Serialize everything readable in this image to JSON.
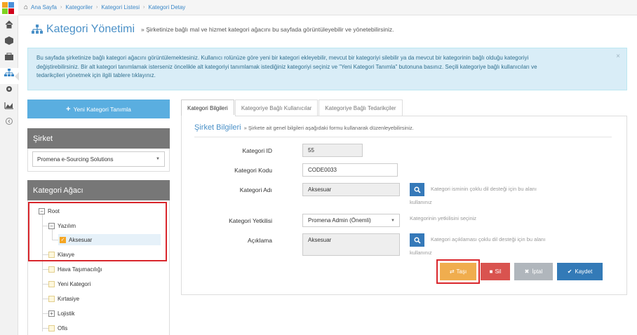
{
  "breadcrumb": {
    "home": "Ana Sayfa",
    "items": [
      "Kategoriler",
      "Kategori Listesi",
      "Kategori Detay"
    ]
  },
  "page": {
    "title": "Kategori Yönetimi",
    "subtitle": "» Şirketinize bağlı mal ve hizmet kategori ağacını bu sayfada görüntüleyebilir ve yönetebilirsiniz."
  },
  "alert": {
    "lines": [
      "Bu sayfada şirketinize bağlı kategori ağacını görüntülemektesiniz. Kullanıcı rolünüze göre yeni bir kategori ekleyebilir, mevcut bir kategoriyi silebilir ya da mevcut bir kategorinin bağlı olduğu kategoriyi",
      "değiştirebilirsiniz. Bir alt kategori tanımlamak isterseniz öncelikle alt kategoriyi tanımlamak istediğiniz kategoriyi seçiniz ve \"Yeni Kategori Tanımla\" butonuna basınız. Seçili kategoriye bağlı kullanıcıları ve",
      "tedarikçileri yönetmek için ilgili tablere tıklayınız."
    ],
    "close": "×"
  },
  "left": {
    "new_button": "Yeni Kategori Tanımla",
    "company_panel_title": "Şirket",
    "company_selected": "Promena e-Sourcing Solutions",
    "tree_panel_title": "Kategori Ağacı",
    "tree": {
      "root": "Root",
      "yazilim": "Yazılım",
      "aksesuar": "Aksesuar",
      "klavye": "Klavye",
      "hava": "Hava Taşımacılığı",
      "yeni": "Yeni Kategori",
      "kirtasiye": "Kırtasiye",
      "lojistik": "Lojistik",
      "ofis": "Ofis"
    }
  },
  "tabs": [
    "Kategori Bilgileri",
    "Kategoriye Bağlı Kullanıcılar",
    "Kategoriye Bağlı Tedarikçiler"
  ],
  "section": {
    "title": "Şirket Bilgileri",
    "subtitle": "» Şirkete ait genel bilgileri aşağıdaki formu kullanarak düzenleyebilirsiniz."
  },
  "form": {
    "id_label": "Kategori ID",
    "id_value": "55",
    "code_label": "Kategori Kodu",
    "code_value": "CODE0033",
    "name_label": "Kategori Adı",
    "name_value": "Aksesuar",
    "name_help_1": "Kategori isminin çoklu dil desteği için bu alanı",
    "name_help_2": "kullanınız",
    "owner_label": "Kategori Yetkilisi",
    "owner_value": "Promena Admin (Önemli)",
    "owner_help": "Kategorinin yetkilisini seçiniz",
    "desc_label": "Açıklama",
    "desc_value": "Aksesuar",
    "desc_help_1": "Kategori açıklaması çoklu dil desteği için bu alanı",
    "desc_help_2": "kullanınız"
  },
  "actions": {
    "move": "Taşı",
    "delete": "Sil",
    "cancel": "İptal",
    "save": "Kaydet"
  },
  "colors": {
    "accent": "#4a90c7",
    "move": "#f0ad4e",
    "delete": "#d9534f",
    "cancel": "#b0b6bc",
    "save": "#337ab7",
    "highlight": "#d9262c"
  }
}
